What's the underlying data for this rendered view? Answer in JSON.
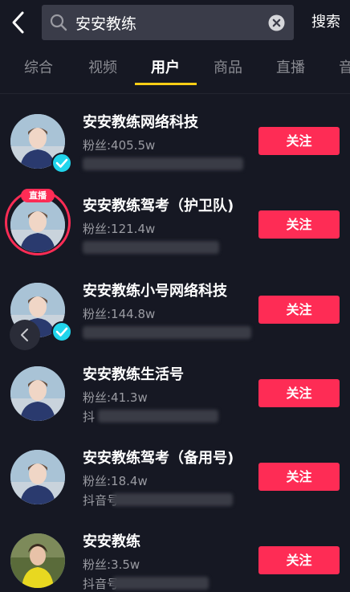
{
  "search": {
    "query": "安安教练",
    "submit_label": "搜索"
  },
  "tabs": [
    {
      "label": "综合",
      "active": false
    },
    {
      "label": "视频",
      "active": false
    },
    {
      "label": "用户",
      "active": true
    },
    {
      "label": "商品",
      "active": false
    },
    {
      "label": "直播",
      "active": false
    },
    {
      "label": "音",
      "active": false
    }
  ],
  "users": [
    {
      "name": "安安教练网络科技",
      "fans": "粉丝:405.5w",
      "id_text": "",
      "verified": true,
      "live": false
    },
    {
      "name": "安安教练驾考（护卫队)",
      "fans": "粉丝:121.4w",
      "id_text": "",
      "verified": false,
      "live": true,
      "live_label": "直播"
    },
    {
      "name": "安安教练小号网络科技",
      "fans": "粉丝:144.8w",
      "id_text": "",
      "verified": true,
      "live": false
    },
    {
      "name": "安安教练生活号",
      "fans": "粉丝:41.3w",
      "id_text": "抖",
      "verified": false,
      "live": false
    },
    {
      "name": "安安教练驾考（备用号)",
      "fans": "粉丝:18.4w",
      "id_text": "抖音号",
      "verified": false,
      "live": false
    },
    {
      "name": "安安教练",
      "fans": "粉丝:3.5w",
      "id_text": "抖音号",
      "verified": false,
      "live": false
    }
  ],
  "follow_label": "关注",
  "colors": {
    "background": "#161823",
    "accent": "#fe2c55",
    "tab_indicator": "#face15",
    "verified": "#20d5ec"
  }
}
